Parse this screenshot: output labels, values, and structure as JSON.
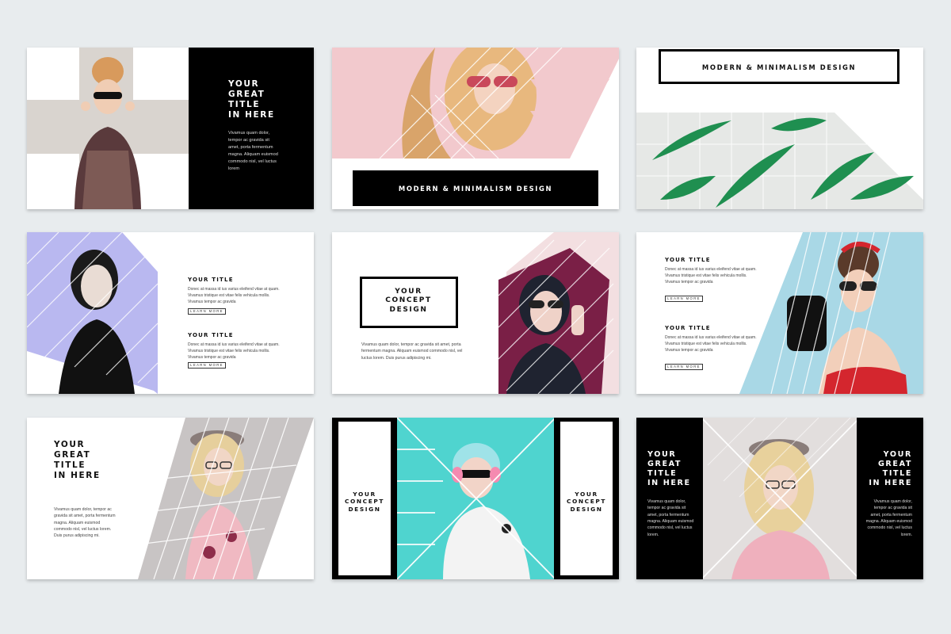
{
  "slides": {
    "s1": {
      "title_lines": [
        "YOUR",
        "GREAT",
        "TITLE",
        "IN HERE"
      ],
      "body": "Vivamus quam dolor, tempor ac gravida sit amet, porta fermentum magna. Aliquam euismod commodo nisl, vel luctus lorem"
    },
    "s2": {
      "banner": "MODERN & MINIMALISM DESIGN"
    },
    "s3": {
      "banner": "MODERN & MINIMALISM DESIGN"
    },
    "s4": {
      "block1_title": "YOUR TITLE",
      "block1_body": "Donec at massa id ius varius eleifend vitae at quam. Vivamus tristique est vitae felis vehicula mollis. Vivamus tempor ac gravida",
      "block1_button": "LEARN MORE",
      "block2_title": "YOUR TITLE",
      "block2_body": "Donec at massa id ius varius eleifend vitae at quam. Vivamus tristique est vitae felis vehicula mollis. Vivamus tempor ac gravida",
      "block2_button": "LEARN MORE"
    },
    "s5": {
      "title_lines": [
        "YOUR",
        "CONCEPT",
        "DESIGN"
      ],
      "body": "Vivamus quam dolor, tempor ac gravida sit amet, porta fermentum magna. Aliquam euismod commodo nisl, vel luctus lorem. Duis purus adipiscing mi."
    },
    "s6": {
      "block1_title": "YOUR TITLE",
      "block1_body": "Donec at massa id ius varius eleifend vitae at quam. Vivamus tristique est vitae felis vehicula mollis. Vivamus tempor ac gravida",
      "block1_button": "LEARN MORE",
      "block2_title": "YOUR TITLE",
      "block2_body": "Donec at massa id ius varius eleifend vitae at quam. Vivamus tristique est vitae felis vehicula mollis. Vivamus tempor ac gravida",
      "block2_button": "LEARN MORE"
    },
    "s7": {
      "title_lines": [
        "YOUR",
        "GREAT",
        "TITLE",
        "IN HERE"
      ],
      "body": "Vivamus quam dolor, tempor ac gravida sit amet, porta fermentum magna. Aliquam euismod commodo nisl, vel luctus lorem. Duis purus adipiscing mi."
    },
    "s8": {
      "left_title_lines": [
        "YOUR",
        "CONCEPT",
        "DESIGN"
      ],
      "right_title_lines": [
        "YOUR",
        "CONCEPT",
        "DESIGN"
      ]
    },
    "s9": {
      "left_title_lines": [
        "YOUR",
        "GREAT",
        "TITLE",
        "IN HERE"
      ],
      "left_body": "Vivamus quam dolor, tempor ac gravida sit amet, porta fermentum magna. Aliquam euismod commodo nisl, vel luctus lorem.",
      "right_title_lines": [
        "YOUR",
        "GREAT",
        "TITLE",
        "IN HERE"
      ],
      "right_body": "Vivamus quam dolor, tempor ac gravida sit amet, porta fermentum magna. Aliquam euismod commodo nisl, vel luctus lorem."
    }
  },
  "colors": {
    "background": "#e8ecee",
    "black": "#000000",
    "pink": "#f0c8cc",
    "lavender": "#b9b8f0",
    "light_blue": "#a9d8e6",
    "teal": "#4fd4cf",
    "leaf_green": "#1f8f50"
  }
}
